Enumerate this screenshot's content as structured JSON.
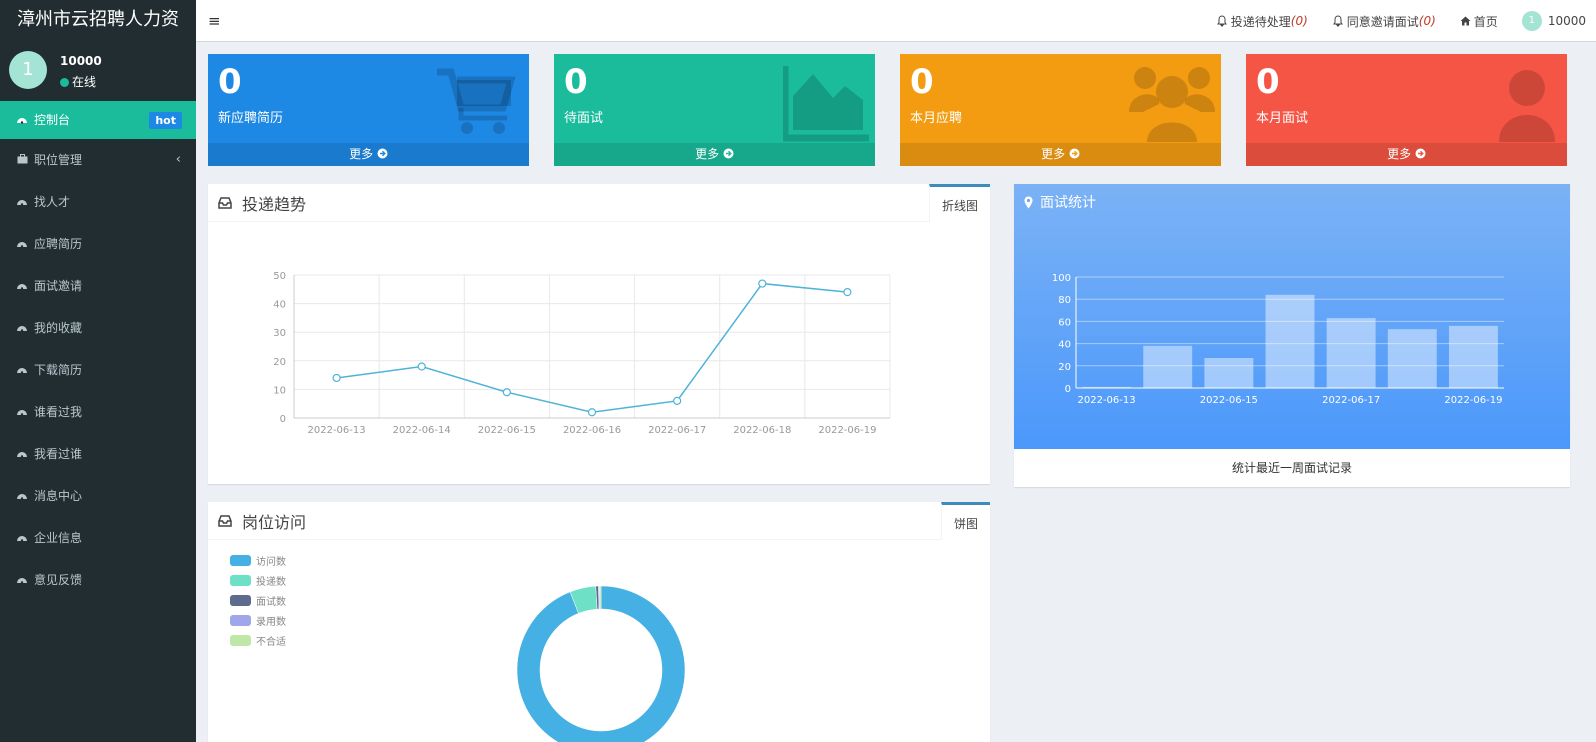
{
  "app": {
    "title": "漳州市云招聘人力资"
  },
  "user": {
    "avatar": "1",
    "name": "10000",
    "status": "在线"
  },
  "sidebar": {
    "items": [
      {
        "label": "控制台",
        "badge": "hot",
        "icon": "dashboard-icon"
      },
      {
        "label": "职位管理",
        "icon": "briefcase-icon",
        "chevron": "‹"
      },
      {
        "label": "找人才",
        "icon": "dashboard-icon"
      },
      {
        "label": "应聘简历",
        "icon": "dashboard-icon"
      },
      {
        "label": "面试邀请",
        "icon": "dashboard-icon"
      },
      {
        "label": "我的收藏",
        "icon": "dashboard-icon"
      },
      {
        "label": "下载简历",
        "icon": "dashboard-icon"
      },
      {
        "label": "谁看过我",
        "icon": "dashboard-icon"
      },
      {
        "label": "我看过谁",
        "icon": "dashboard-icon"
      },
      {
        "label": "消息中心",
        "icon": "dashboard-icon"
      },
      {
        "label": "企业信息",
        "icon": "dashboard-icon"
      },
      {
        "label": "意见反馈",
        "icon": "dashboard-icon"
      }
    ]
  },
  "header": {
    "pending_label": "投递待处理",
    "pending_count": "(0)",
    "invite_label": "同意邀请面试",
    "invite_count": "(0)",
    "home_label": "首页",
    "user_avatar": "1",
    "user_name": "10000"
  },
  "cards": [
    {
      "value": "0",
      "label": "新应聘简历",
      "more": "更多",
      "color": "#1e88e5",
      "icon": "cart-icon"
    },
    {
      "value": "0",
      "label": "待面试",
      "more": "更多",
      "color": "#1abc9c",
      "icon": "area-chart-icon"
    },
    {
      "value": "0",
      "label": "本月应聘",
      "more": "更多",
      "color": "#f39c12",
      "icon": "users-icon"
    },
    {
      "value": "0",
      "label": "本月面试",
      "more": "更多",
      "color": "#f55545",
      "icon": "user-icon"
    }
  ],
  "trend_box": {
    "title": "投递趋势",
    "tab": "折线图"
  },
  "interview_box": {
    "title": "面试统计",
    "footer": "统计最近一周面试记录"
  },
  "visit_box": {
    "title": "岗位访问",
    "tab": "饼图"
  },
  "chart_data": [
    {
      "type": "line",
      "categories": [
        "2022-06-13",
        "2022-06-14",
        "2022-06-15",
        "2022-06-16",
        "2022-06-17",
        "2022-06-18",
        "2022-06-19"
      ],
      "values": [
        14,
        18,
        9,
        2,
        6,
        47,
        44
      ],
      "yticks": [
        0,
        10,
        20,
        30,
        40,
        50
      ],
      "ylim": [
        0,
        50
      ],
      "color": "#4fb3d8",
      "grid": true
    },
    {
      "type": "bar",
      "categories": [
        "2022-06-13",
        "2022-06-14",
        "2022-06-15",
        "2022-06-16",
        "2022-06-17",
        "2022-06-18",
        "2022-06-19"
      ],
      "xtick_labels": [
        "2022-06-13",
        "2022-06-15",
        "2022-06-17",
        "2022-06-19"
      ],
      "values": [
        1,
        38,
        27,
        84,
        63,
        53,
        56
      ],
      "yticks": [
        0,
        20,
        40,
        60,
        80,
        100
      ],
      "ylim": [
        0,
        100
      ],
      "grid": true
    },
    {
      "type": "pie",
      "legend": [
        "访问数",
        "投递数",
        "面试数",
        "录用数",
        "不合适"
      ],
      "colors": [
        "#44b0e3",
        "#6ee0c5",
        "#5d6b8e",
        "#a0a6ea",
        "#bfe8a8"
      ],
      "values": [
        94,
        5,
        0.5,
        0.2,
        0.3
      ],
      "legend_position": "top-left"
    }
  ]
}
